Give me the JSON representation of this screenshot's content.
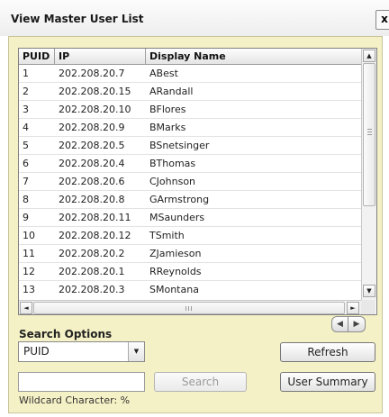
{
  "window": {
    "title": "View Master User List",
    "close_label": "x"
  },
  "table": {
    "columns": [
      "PUID",
      "IP",
      "Display Name"
    ],
    "rows": [
      [
        "1",
        "202.208.20.7",
        "ABest"
      ],
      [
        "2",
        "202.208.20.15",
        "ARandall"
      ],
      [
        "3",
        "202.208.20.10",
        "BFlores"
      ],
      [
        "4",
        "202.208.20.9",
        "BMarks"
      ],
      [
        "5",
        "202.208.20.5",
        "BSnetsinger"
      ],
      [
        "6",
        "202.208.20.4",
        "BThomas"
      ],
      [
        "7",
        "202.208.20.6",
        "CJohnson"
      ],
      [
        "8",
        "202.208.20.8",
        "GArmstrong"
      ],
      [
        "9",
        "202.208.20.11",
        "MSaunders"
      ],
      [
        "10",
        "202.208.20.12",
        "TSmith"
      ],
      [
        "11",
        "202.208.20.2",
        "ZJamieson"
      ],
      [
        "12",
        "202.208.20.1",
        "RReynolds"
      ],
      [
        "13",
        "202.208.20.3",
        "SMontana"
      ]
    ]
  },
  "search": {
    "options_label": "Search Options",
    "selected_option": "PUID",
    "query_value": "",
    "search_label": "Search",
    "wildcard_text": "Wildcard Character: %"
  },
  "buttons": {
    "refresh_label": "Refresh",
    "summary_label": "User Summary"
  },
  "icons": {
    "scroll_up": "▲",
    "scroll_down": "▼",
    "scroll_left": "◄",
    "scroll_right": "►",
    "nav_prev": "◀",
    "nav_next": "▶",
    "dropdown": "▼"
  },
  "colors": {
    "panel_bg": "#f5f1c6",
    "panel_border": "#c9c39b"
  }
}
